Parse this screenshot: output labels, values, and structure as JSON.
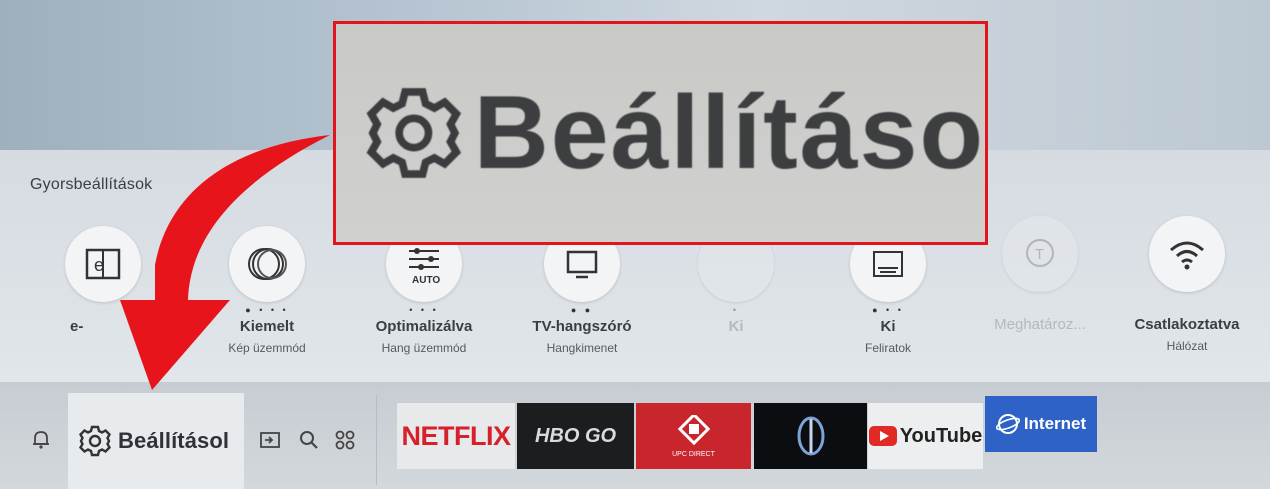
{
  "quick_settings": {
    "title": "Gyorsbeállítások",
    "items": [
      {
        "label": "e-",
        "sub": "",
        "dots": "",
        "icon": "e-manual-icon"
      },
      {
        "label": "Kiemelt",
        "sub": "Kép üzemmód",
        "dots": "● • • •",
        "icon": "picture-mode-icon"
      },
      {
        "label": "Optimalizálva",
        "sub": "Hang üzemmód",
        "dots": "• • •",
        "icon": "sound-mode-icon",
        "icon_text": "AUTO"
      },
      {
        "label": "TV-hangszóró",
        "sub": "Hangkimenet",
        "dots": "● ●",
        "icon": "tv-speaker-icon"
      },
      {
        "label": "Ki",
        "sub": "",
        "dots": "•",
        "icon": "game-mode-icon"
      },
      {
        "label": "Ki",
        "sub": "Feliratok",
        "dots": "● • •",
        "icon": "subtitles-icon"
      },
      {
        "label": "Meghatároz...",
        "sub": "",
        "dots": "",
        "icon": "speech-icon",
        "icon_text": "T"
      },
      {
        "label": "Csatlakoztatva",
        "sub": "Hálózat",
        "dots": "",
        "icon": "wifi-icon"
      }
    ]
  },
  "bottom_bar": {
    "settings_label": "Beállításol",
    "apps": {
      "netflix": "NETFLIX",
      "hbo": "HBO GO",
      "upc": "UPC DIRECT",
      "youtube": "YouTube",
      "internet": "Internet"
    }
  },
  "callout": {
    "label": "Beállításo",
    "border_color": "#e3141b"
  },
  "colors": {
    "arrow": "#e8141b",
    "netflix": "#d6202a",
    "upc": "#c9252c",
    "internet": "#2e62c7"
  }
}
